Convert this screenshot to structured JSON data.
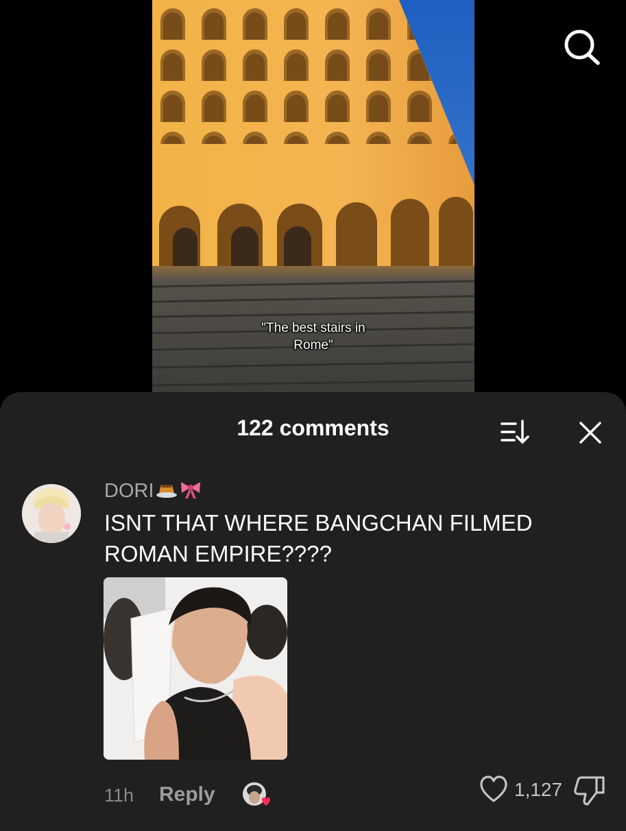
{
  "video": {
    "caption_line1": "\"The best stairs in",
    "caption_line2": "Rome\""
  },
  "comments_panel": {
    "title": "122 comments"
  },
  "comment": {
    "username": "DORI",
    "username_emojis": [
      "pudding-emoji",
      "ribbon-emoji"
    ],
    "text_line1": "ISNT THAT WHERE BANGCHAN FILMED",
    "text_line2": "ROMAN EMPIRE????",
    "time": "11h",
    "reply_label": "Reply",
    "like_count": "1,127"
  },
  "icons": {
    "search": "search-icon",
    "sort": "sort-icon",
    "close": "close-icon",
    "like": "heart-icon",
    "dislike": "dislike-icon"
  },
  "colors": {
    "sheet_bg": "#202020",
    "primary_text": "#ffffff",
    "secondary_text": "#a8a8a8",
    "liked_heart": "#fe2c55"
  }
}
